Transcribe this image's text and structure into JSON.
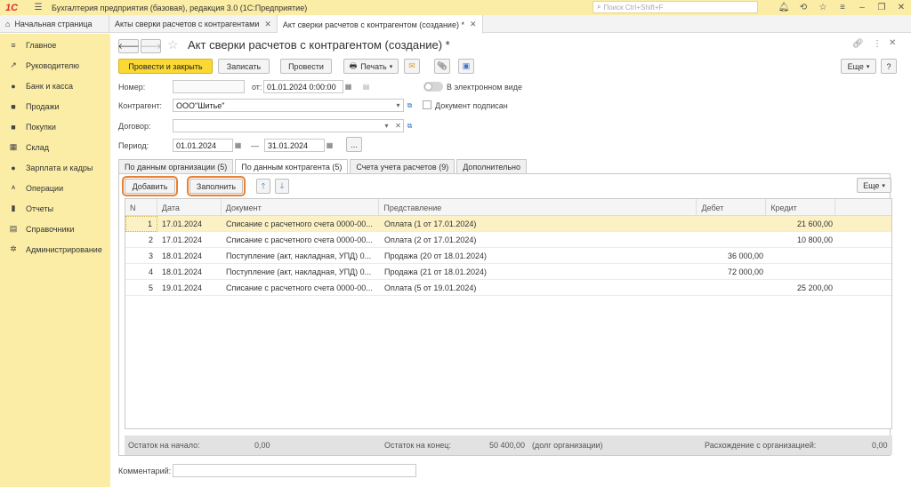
{
  "titlebar": {
    "logo": "1С",
    "app_title": "Бухгалтерия предприятия (базовая), редакция 3.0  (1С:Предприятие)",
    "search_placeholder": "Поиск Ctrl+Shift+F"
  },
  "window_tabs": [
    {
      "label": "Начальная страница"
    },
    {
      "label": "Акты сверки расчетов с контрагентами"
    },
    {
      "label": "Акт сверки расчетов с контрагентом (создание) *"
    }
  ],
  "sidebar": {
    "items": [
      {
        "label": "Главное",
        "icon": "≡"
      },
      {
        "label": "Руководителю",
        "icon": "↗"
      },
      {
        "label": "Банк и касса",
        "icon": "●"
      },
      {
        "label": "Продажи",
        "icon": "■"
      },
      {
        "label": "Покупки",
        "icon": "■"
      },
      {
        "label": "Склад",
        "icon": "▦"
      },
      {
        "label": "Зарплата и кадры",
        "icon": "●"
      },
      {
        "label": "Операции",
        "icon": "ᴬ"
      },
      {
        "label": "Отчеты",
        "icon": "▮"
      },
      {
        "label": "Справочники",
        "icon": "▤"
      },
      {
        "label": "Администрирование",
        "icon": "✲"
      }
    ]
  },
  "doc": {
    "title": "Акт сверки расчетов с контрагентом (создание) *",
    "toolbar": {
      "post_close": "Провести и закрыть",
      "save": "Записать",
      "post": "Провести",
      "print": "Печать",
      "more": "Еще",
      "help": "?"
    },
    "form": {
      "number_label": "Номер:",
      "number_value": "",
      "from_label": "от:",
      "date_value": "01.01.2024  0:00:00",
      "electronic_label": "В электронном виде",
      "counterparty_label": "Контрагент:",
      "counterparty_value": "ООО\"Шитье\"",
      "signed_label": "Документ подписан",
      "contract_label": "Договор:",
      "contract_value": "",
      "period_label": "Период:",
      "period_from": "01.01.2024",
      "period_dash": "—",
      "period_to": "31.01.2024",
      "period_btn": "..."
    },
    "tabs": [
      {
        "label": "По данным организации (5)"
      },
      {
        "label": "По данным контрагента (5)"
      },
      {
        "label": "Счета учета расчетов (9)"
      },
      {
        "label": "Дополнительно"
      }
    ],
    "grid_toolbar": {
      "add": "Добавить",
      "fill": "Заполнить",
      "more": "Еще"
    },
    "table": {
      "headers": [
        "N",
        "Дата",
        "Документ",
        "Представление",
        "Дебет",
        "Кредит"
      ],
      "rows": [
        {
          "n": "1",
          "date": "17.01.2024",
          "doc": "Списание с расчетного счета 0000-00...",
          "repr": "Оплата (1 от 17.01.2024)",
          "debit": "",
          "credit": "21 600,00"
        },
        {
          "n": "2",
          "date": "17.01.2024",
          "doc": "Списание с расчетного счета 0000-00...",
          "repr": "Оплата (2 от 17.01.2024)",
          "debit": "",
          "credit": "10 800,00"
        },
        {
          "n": "3",
          "date": "18.01.2024",
          "doc": "Поступление (акт, накладная, УПД) 0...",
          "repr": "Продажа (20 от 18.01.2024)",
          "debit": "36 000,00",
          "credit": ""
        },
        {
          "n": "4",
          "date": "18.01.2024",
          "doc": "Поступление (акт, накладная, УПД) 0...",
          "repr": "Продажа (21 от 18.01.2024)",
          "debit": "72 000,00",
          "credit": ""
        },
        {
          "n": "5",
          "date": "19.01.2024",
          "doc": "Списание с расчетного счета 0000-00...",
          "repr": "Оплата (5 от 19.01.2024)",
          "debit": "",
          "credit": "25 200,00"
        }
      ]
    },
    "footer": {
      "start_label": "Остаток на начало:",
      "start_value": "0,00",
      "end_label": "Остаток на конец:",
      "end_value": "50 400,00",
      "end_note": "(долг организации)",
      "diff_label": "Расхождение с организацией:",
      "diff_value": "0,00"
    },
    "comment_label": "Комментарий:",
    "comment_value": ""
  }
}
